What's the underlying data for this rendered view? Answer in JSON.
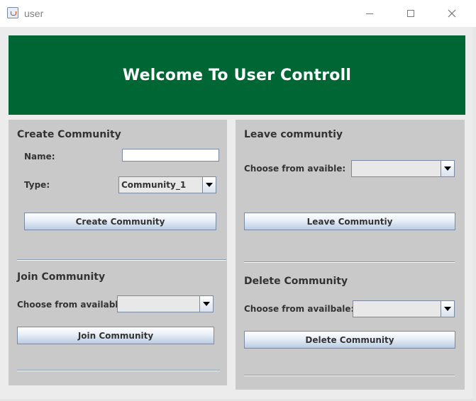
{
  "window": {
    "title": "user",
    "minimize_icon": "minimize-icon",
    "maximize_icon": "maximize-icon",
    "close_icon": "close-icon"
  },
  "banner": {
    "title": "Welcome To User Controll",
    "color": "#006633"
  },
  "create": {
    "title": "Create Community",
    "name_label": "Name:",
    "name_value": "",
    "type_label": "Type:",
    "type_value": "Community_1",
    "button": "Create Community"
  },
  "join": {
    "title": "Join Community",
    "choose_label": "Choose from available:",
    "choose_value": "",
    "button": "Join Community"
  },
  "leave": {
    "title": "Leave communtiy",
    "choose_label": "Choose from avaible:",
    "choose_value": "",
    "button": "Leave Communtiy"
  },
  "delete": {
    "title": "Delete Community",
    "choose_label": "Choose from availbale:",
    "choose_value": "",
    "button": "Delete Community"
  }
}
